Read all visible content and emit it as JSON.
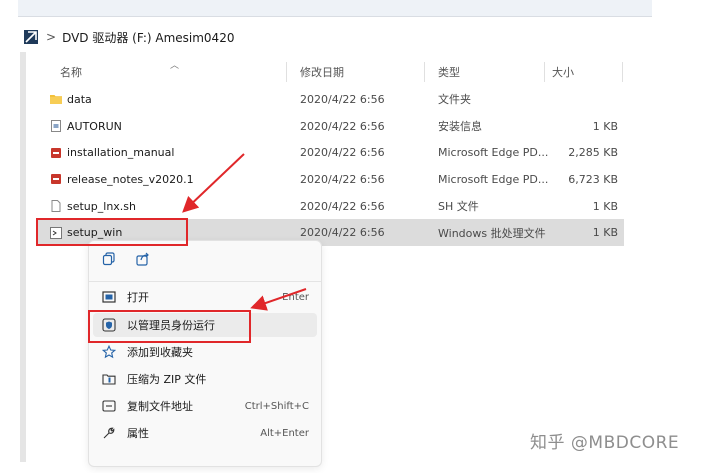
{
  "address": {
    "separator": ">",
    "path": "DVD 驱动器 (F:) Amesim0420"
  },
  "columns": {
    "name": "名称",
    "date": "修改日期",
    "type": "类型",
    "size": "大小"
  },
  "files": [
    {
      "name": "data",
      "date": "2020/4/22 6:56",
      "type": "文件夹",
      "size": "",
      "icon": "folder-icon"
    },
    {
      "name": "AUTORUN",
      "date": "2020/4/22 6:56",
      "type": "安装信息",
      "size": "1 KB",
      "icon": "setup-info-icon"
    },
    {
      "name": "installation_manual",
      "date": "2020/4/22 6:56",
      "type": "Microsoft Edge PD...",
      "size": "2,285 KB",
      "icon": "pdf-icon"
    },
    {
      "name": "release_notes_v2020.1",
      "date": "2020/4/22 6:56",
      "type": "Microsoft Edge PD...",
      "size": "6,723 KB",
      "icon": "pdf-icon"
    },
    {
      "name": "setup_lnx.sh",
      "date": "2020/4/22 6:56",
      "type": "SH 文件",
      "size": "1 KB",
      "icon": "file-icon"
    },
    {
      "name": "setup_win",
      "date": "2020/4/22 6:56",
      "type": "Windows 批处理文件",
      "size": "1 KB",
      "icon": "batch-file-icon"
    }
  ],
  "context_menu": {
    "quick_actions": [
      "copy-icon",
      "share-icon"
    ],
    "items": [
      {
        "label": "打开",
        "shortcut": "Enter",
        "icon": "open-icon"
      },
      {
        "label": "以管理员身份运行",
        "shortcut": "",
        "icon": "admin-shield-icon"
      },
      {
        "label": "添加到收藏夹",
        "shortcut": "",
        "icon": "star-icon"
      },
      {
        "label": "压缩为 ZIP 文件",
        "shortcut": "",
        "icon": "zip-icon"
      },
      {
        "label": "复制文件地址",
        "shortcut": "Ctrl+Shift+C",
        "icon": "copy-path-icon"
      },
      {
        "label": "属性",
        "shortcut": "Alt+Enter",
        "icon": "properties-icon"
      }
    ]
  },
  "watermark": "知乎 @MBDCORE",
  "colors": {
    "highlight": "#e0272a",
    "selected_row": "#dcdcdc",
    "folder": "#f3c13a",
    "pdf": "#c8362b"
  }
}
